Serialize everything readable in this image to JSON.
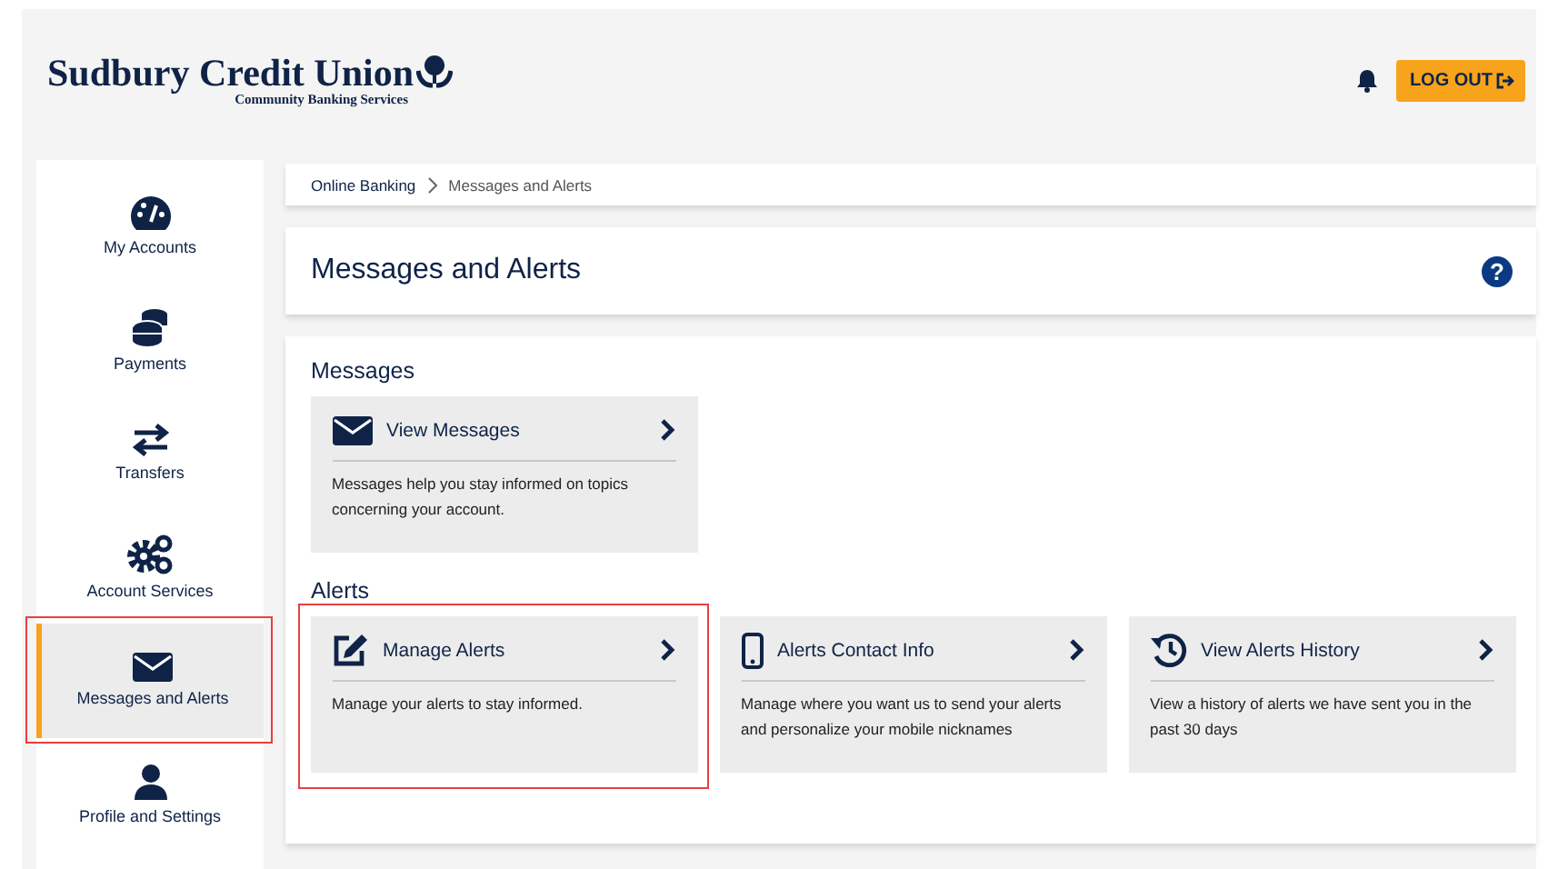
{
  "header": {
    "logo_name": "Sudbury Credit Union",
    "logo_tagline": "Community Banking Services",
    "logout": "LOG OUT"
  },
  "sidebar": {
    "items": [
      {
        "label": "My Accounts",
        "selected": false,
        "highlighted": false
      },
      {
        "label": "Payments",
        "selected": false,
        "highlighted": false
      },
      {
        "label": "Transfers",
        "selected": false,
        "highlighted": false
      },
      {
        "label": "Account Services",
        "selected": false,
        "highlighted": false
      },
      {
        "label": "Messages and Alerts",
        "selected": true,
        "highlighted": true
      },
      {
        "label": "Profile and Settings",
        "selected": false,
        "highlighted": false
      }
    ]
  },
  "breadcrumb": [
    "Online Banking",
    "Messages and Alerts"
  ],
  "page_title": "Messages and Alerts",
  "help": "?",
  "sections": [
    {
      "title": "Messages",
      "cards": [
        {
          "title": "View Messages",
          "text": "Messages help you stay informed on topics concerning your account.",
          "highlighted": false
        }
      ]
    },
    {
      "title": "Alerts",
      "cards": [
        {
          "title": "Manage Alerts",
          "text": "Manage your alerts to stay informed.",
          "highlighted": true
        },
        {
          "title": "Alerts Contact Info",
          "text": "Manage where you want us to send your alerts and personalize your mobile nicknames",
          "highlighted": false
        },
        {
          "title": "View Alerts History",
          "text": "View a history of alerts we have sent you in the past 30 days",
          "highlighted": false
        }
      ]
    }
  ]
}
